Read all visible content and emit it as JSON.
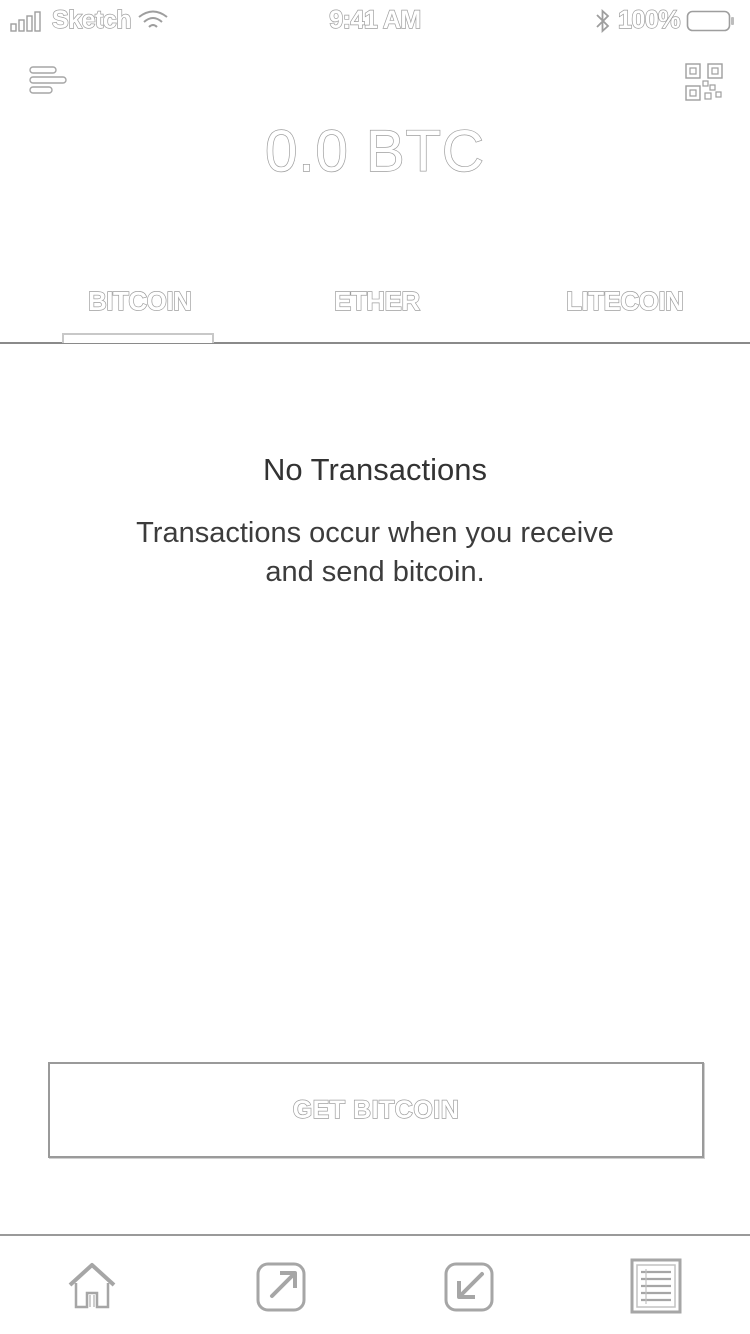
{
  "status_bar": {
    "carrier": "Sketch",
    "time": "9:41 AM",
    "battery": "100%",
    "icons": [
      "signal-icon",
      "wifi-icon",
      "bluetooth-icon",
      "battery-icon"
    ]
  },
  "header": {
    "menu_icon": "menu-icon",
    "qr_icon": "qr-code-icon",
    "balance": "0.0 BTC"
  },
  "tabs": [
    {
      "label": "BITCOIN",
      "selected": true
    },
    {
      "label": "ETHER",
      "selected": false
    },
    {
      "label": "LITECOIN",
      "selected": false
    }
  ],
  "empty_state": {
    "title": "No Transactions",
    "line1": "Transactions occur when you receive",
    "line2": "and send bitcoin."
  },
  "cta": {
    "label": "GET BITCOIN"
  },
  "tab_bar": {
    "items": [
      "home-icon",
      "send-icon",
      "receive-icon",
      "transactions-icon"
    ]
  },
  "colors": {
    "background": "#ffffff",
    "outline": "#9e9e9e",
    "text": "#3a3a3a"
  }
}
